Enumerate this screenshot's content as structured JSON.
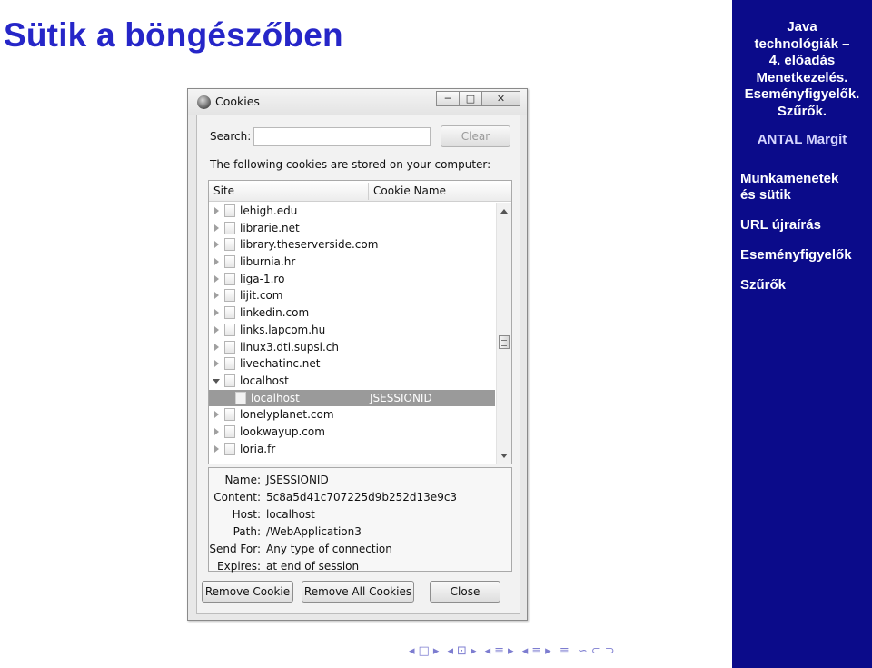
{
  "slide": {
    "title": "Sütik a böngészőben"
  },
  "sidebar": {
    "course_title": [
      "Java",
      "technológiák –",
      "4. előadás",
      "Menetkezelés.",
      "Eseményfigyelők.",
      "Szűrők."
    ],
    "author": "ANTAL Margit",
    "nav": [
      {
        "label": "Munkamenetek és sütik",
        "lines": [
          "Munkamenetek",
          "és sütik"
        ],
        "active": true
      },
      {
        "label": "URL újraírás",
        "lines": [
          "URL újraírás"
        ],
        "active": false
      },
      {
        "label": "Eseményfigyelők",
        "lines": [
          "Eseményfigyelők"
        ],
        "active": false
      },
      {
        "label": "Szűrők",
        "lines": [
          "Szűrők"
        ],
        "active": false
      }
    ],
    "colors": {
      "background": "#0b0b8a",
      "text": "#ffffff"
    }
  },
  "window": {
    "title": "Cookies",
    "icon": "firefox-globe-icon",
    "controls": {
      "minimize": "─",
      "maximize": "□",
      "close": "✕"
    },
    "search": {
      "label": "Search:",
      "value": "",
      "placeholder": ""
    },
    "clear_label": "Clear",
    "info_text": "The following cookies are stored on your computer:",
    "tree": {
      "columns": [
        "Site",
        "Cookie Name"
      ],
      "rows": [
        {
          "site": "lehigh.edu",
          "expanded": false
        },
        {
          "site": "librarie.net",
          "expanded": false
        },
        {
          "site": "library.theserverside.com",
          "expanded": false
        },
        {
          "site": "liburnia.hr",
          "expanded": false
        },
        {
          "site": "liga-1.ro",
          "expanded": false
        },
        {
          "site": "lijit.com",
          "expanded": false
        },
        {
          "site": "linkedin.com",
          "expanded": false
        },
        {
          "site": "links.lapcom.hu",
          "expanded": false
        },
        {
          "site": "linux3.dti.supsi.ch",
          "expanded": false
        },
        {
          "site": "livechatinc.net",
          "expanded": false
        },
        {
          "site": "localhost",
          "expanded": true
        },
        {
          "site": "localhost",
          "cookie": "JSESSIONID",
          "child": true,
          "selected": true
        },
        {
          "site": "lonelyplanet.com",
          "expanded": false
        },
        {
          "site": "lookwayup.com",
          "expanded": false
        },
        {
          "site": "loria.fr",
          "expanded": false
        }
      ]
    },
    "details": [
      {
        "label": "Name:",
        "value": "JSESSIONID"
      },
      {
        "label": "Content:",
        "value": "5c8a5d41c707225d9b252d13e9c3"
      },
      {
        "label": "Host:",
        "value": "localhost"
      },
      {
        "label": "Path:",
        "value": "/WebApplication3"
      },
      {
        "label": "Send For:",
        "value": "Any type of connection"
      },
      {
        "label": "Expires:",
        "value": "at end of session"
      }
    ],
    "buttons": {
      "remove_cookie": "Remove Cookie",
      "remove_all": "Remove All Cookies",
      "close": "Close"
    }
  },
  "beamer_nav": [
    "◂",
    "□",
    "▸",
    "◂",
    "⊡",
    "▸",
    "◂",
    "≡",
    "▸",
    "◂",
    "≡",
    "▸",
    "≡",
    "∽",
    "⊂",
    "⊃"
  ]
}
